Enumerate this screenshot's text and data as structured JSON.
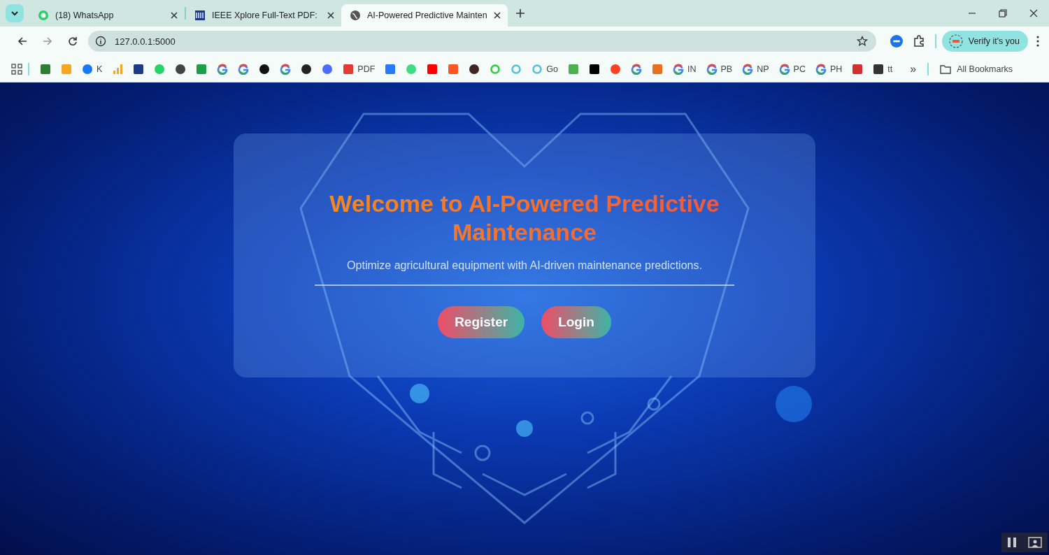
{
  "tabs": [
    {
      "title": "(18) WhatsApp",
      "kind": "chat",
      "selected": false
    },
    {
      "title": "IEEE Xplore Full-Text PDF:",
      "kind": "logo",
      "selected": false
    },
    {
      "title": "AI-Powered Predictive Mainten",
      "kind": "web",
      "selected": true
    }
  ],
  "address_bar": {
    "url": "127.0.0.1:5000"
  },
  "profile_button": {
    "label": "Verify it's you"
  },
  "bookmarks": [
    {
      "kind": "square",
      "color": "#2e7d32"
    },
    {
      "kind": "square",
      "color": "#f5a623"
    },
    {
      "kind": "circle",
      "color": "#1877f2",
      "label": "K"
    },
    {
      "kind": "bars",
      "color": "#f5a623"
    },
    {
      "kind": "square",
      "color": "#1a3a8a"
    },
    {
      "kind": "circle",
      "color": "#25d366"
    },
    {
      "kind": "circle",
      "color": "#444444"
    },
    {
      "kind": "square",
      "color": "#1e9e4a"
    },
    {
      "kind": "g",
      "color": "#4285f4"
    },
    {
      "kind": "g",
      "color": "#4285f4"
    },
    {
      "kind": "circle",
      "color": "#111111"
    },
    {
      "kind": "g",
      "color": "#4285f4"
    },
    {
      "kind": "circle",
      "color": "#222222"
    },
    {
      "kind": "circle",
      "color": "#4d6bfe"
    },
    {
      "kind": "square",
      "color": "#e53935",
      "label": "PDF"
    },
    {
      "kind": "square",
      "color": "#2979ff"
    },
    {
      "kind": "circle",
      "color": "#3ddc84"
    },
    {
      "kind": "square",
      "color": "#ff0000"
    },
    {
      "kind": "square",
      "color": "#ff5722"
    },
    {
      "kind": "circle",
      "color": "#3e2723"
    },
    {
      "kind": "ring",
      "color": "#2ecc40"
    },
    {
      "kind": "ring",
      "color": "#4fc3d7"
    },
    {
      "kind": "ring",
      "color": "#4fc3d7",
      "label": "Go"
    },
    {
      "kind": "square",
      "color": "#4caf50"
    },
    {
      "kind": "square",
      "color": "#000000"
    },
    {
      "kind": "circle",
      "color": "#fc3f1d"
    },
    {
      "kind": "g",
      "color": "#4285f4"
    },
    {
      "kind": "square",
      "color": "#e76f21"
    },
    {
      "kind": "g",
      "color": "#4285f4",
      "label": "IN"
    },
    {
      "kind": "g",
      "color": "#4285f4",
      "label": "PB"
    },
    {
      "kind": "g",
      "color": "#4285f4",
      "label": "NP"
    },
    {
      "kind": "g",
      "color": "#4285f4",
      "label": "PC"
    },
    {
      "kind": "g",
      "color": "#4285f4",
      "label": "PH"
    },
    {
      "kind": "square",
      "color": "#d32f2f"
    },
    {
      "kind": "square",
      "color": "#333333",
      "label": "tt"
    }
  ],
  "bookmarks_overflow": "»",
  "all_bookmarks": "All Bookmarks",
  "hero": {
    "title": "Welcome to AI-Powered Predictive Maintenance",
    "subtitle": "Optimize agricultural equipment with AI-driven maintenance predictions.",
    "buttons": [
      "Register",
      "Login"
    ]
  }
}
